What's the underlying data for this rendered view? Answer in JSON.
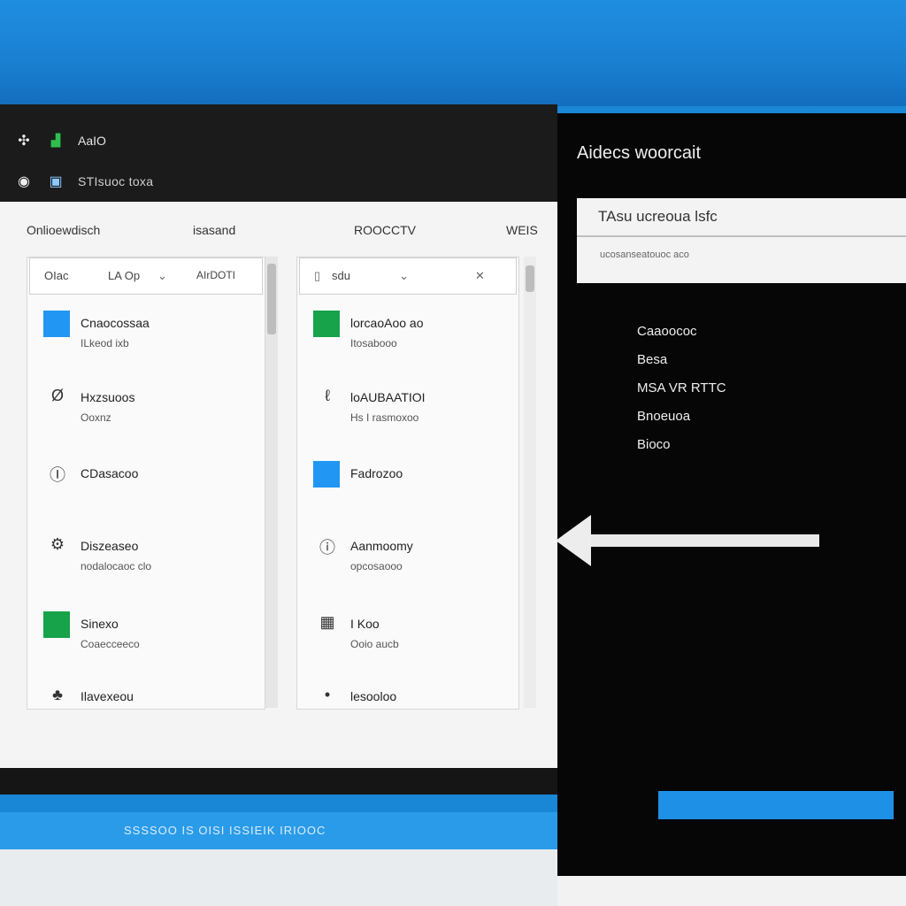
{
  "window": {
    "title_row1": "AaIO",
    "title_row2_sub": "STIsuoc toxa"
  },
  "columns": {
    "col1": "Onlioewdisch",
    "col2": "isasand",
    "col3": "ROOCCTV",
    "col4": "WEIS"
  },
  "left_panel": {
    "search": {
      "left_text": "OIac",
      "mid_text": "LA Op",
      "right_text": "AIrDOTI"
    },
    "items": [
      {
        "title": "Cnaocossaa",
        "subtitle": "ILkeod ixb",
        "icon": "app-icon-blue"
      },
      {
        "title": "Hxzsuoos",
        "subtitle": "Ooxnz",
        "icon": "letter-icon"
      },
      {
        "title": "CDasacoo",
        "subtitle": "",
        "icon": "circle-icon"
      },
      {
        "title": "Diszeaseo",
        "subtitle": "nodalocaoc clo",
        "icon": "gear-icon"
      },
      {
        "title": "Sinexo",
        "subtitle": "Coaecceeco",
        "icon": "app-icon-green"
      },
      {
        "title": "Ilavexeou",
        "subtitle": "",
        "icon": "pin-icon"
      }
    ]
  },
  "right_panel": {
    "search": {
      "text": "sdu"
    },
    "items": [
      {
        "title": "lorcaoAoo ao",
        "subtitle": "Itosabooo",
        "icon": "app-icon-green"
      },
      {
        "title": "loAUBAATIOI",
        "subtitle": "Hs I rasmoxoo",
        "icon": "letter-icon"
      },
      {
        "title": "Fadrozoo",
        "subtitle": "",
        "icon": "app-icon-blue"
      },
      {
        "title": "Aanmoomy",
        "subtitle": "opcosaooo",
        "icon": "key-icon"
      },
      {
        "title": "I Koo",
        "subtitle": "Ooio aucb",
        "icon": "grid-icon"
      },
      {
        "title": "lesooloo",
        "subtitle": "",
        "icon": "dot-icon"
      }
    ]
  },
  "status_band": {
    "text": "SSSSOO IS OISI ISSIEIK IRIOOC"
  },
  "side_panel": {
    "title": "Aidecs woorcait",
    "input": {
      "value": "TAsu ucreoua lsfc",
      "hint": "ucosanseatouoc aco"
    },
    "options": [
      "Caaoococ",
      "Besa",
      "MSA VR RTTC",
      "Bnoeuoa",
      "Bioco"
    ]
  },
  "colors": {
    "accent_blue": "#1e90e6",
    "accent_green": "#16a34a",
    "panel_dark": "#060606"
  }
}
